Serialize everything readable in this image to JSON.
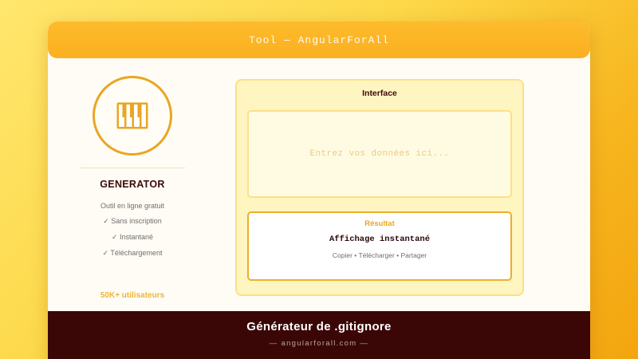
{
  "window": {
    "title": "Tool — AngularForAll"
  },
  "sidebar": {
    "logo_icon": "piano-keys-icon",
    "name": "GENERATOR",
    "tagline": "Outil en ligne gratuit",
    "features": [
      "✓ Sans inscription",
      "✓ Instantané",
      "✓ Téléchargement"
    ],
    "users": "50K+ utilisateurs"
  },
  "interface": {
    "title": "Interface",
    "input_placeholder": "Entrez vos données ici...",
    "result_label": "Résultat",
    "result_main": "Affichage instantané",
    "result_actions": "Copier • Télécharger • Partager"
  },
  "footer": {
    "title": "Générateur de .gitignore",
    "subtitle": "— angularforall.com —"
  },
  "colors": {
    "accent": "#e9a623",
    "titlebar": "#fbb020",
    "footer_bg": "#3a0606",
    "panel_bg": "#fff5c0"
  }
}
